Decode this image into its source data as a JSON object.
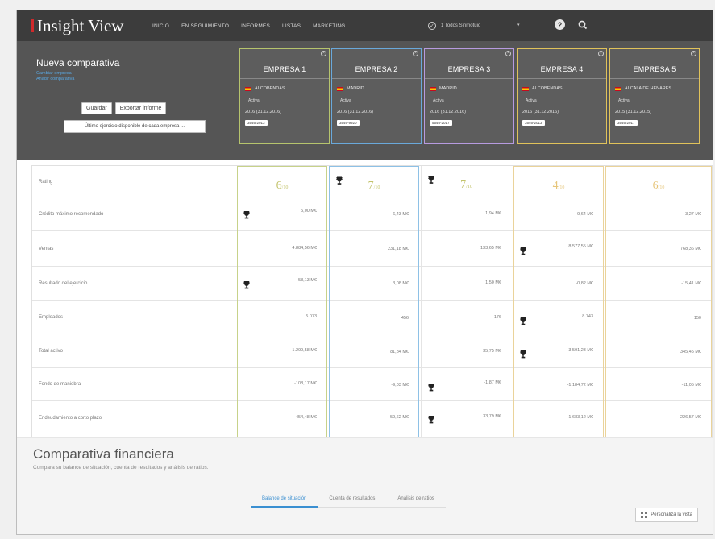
{
  "app": {
    "logo": "Insight View"
  },
  "nav": [
    "INICIO",
    "EN SEGUIMIENTO",
    "INFORMES",
    "LISTAS",
    "MARKETING"
  ],
  "user": {
    "label": "1 Todos Sinmotuio"
  },
  "header": {
    "title": "Nueva comparativa",
    "links": [
      "Cambiar empresa",
      "Añadir comparativa"
    ],
    "buttons": {
      "save": "Guardar",
      "export": "Exportar informe"
    },
    "period_select": "Último ejercicio disponible de cada empresa ..."
  },
  "companies": [
    {
      "name": "EMPRESA 1",
      "location": "ALCOBENDAS",
      "status": "Activa",
      "date": "2016 (31.12.2016)",
      "code": "3546-2013",
      "color": "#b6c46d"
    },
    {
      "name": "EMPRESA 2",
      "location": "MADRID",
      "status": "Activa",
      "date": "2016 (31.12.2016)",
      "code": "3546-9920",
      "color": "#6aa9db"
    },
    {
      "name": "EMPRESA 3",
      "location": "MADRID",
      "status": "Activa",
      "date": "2016 (31.12.2016)",
      "code": "5546-2017",
      "color": "#b79be0"
    },
    {
      "name": "EMPRESA 4",
      "location": "ALCOBENDAS",
      "status": "Activa",
      "date": "2016 (31.12.2016)",
      "code": "3546-2013",
      "color": "#e0c25a"
    },
    {
      "name": "EMPRESA 5",
      "location": "ALCALA DE HENARES",
      "status": "Activa",
      "date": "2015 (31.12.2015)",
      "code": "3546-2017",
      "color": "#e0c25a"
    }
  ],
  "table": {
    "rows": [
      "Rating",
      "Crédito máximo recomendado",
      "Ventas",
      "Resultado del ejercicio",
      "Empleados",
      "Total activo",
      "Fondo de maniobra",
      "Endeudamiento a corto plazo"
    ],
    "ratings": [
      {
        "value": "6",
        "suffix": "/10",
        "color": "#c3c36b"
      },
      {
        "value": "7",
        "suffix": "/10",
        "color": "#c3c36b"
      },
      {
        "value": "7",
        "suffix": "/10",
        "color": "#c3c36b"
      },
      {
        "value": "4",
        "suffix": "/10",
        "color": "#e6c57a"
      },
      {
        "value": "6",
        "suffix": "/10",
        "color": "#e6c57a"
      }
    ],
    "values": [
      [
        "5,00 M€",
        "6,43 M€",
        "1,94 M€",
        "9,64 M€",
        "3,27 M€"
      ],
      [
        "4.884,56 M€",
        "231,18 M€",
        "133,65 M€",
        "8.577,55 M€",
        "768,36 M€"
      ],
      [
        "58,13 M€",
        "3,08 M€",
        "1,50 M€",
        "-0,82 M€",
        "-15,41 M€"
      ],
      [
        "5.073",
        "456",
        "176",
        "8.743",
        "150"
      ],
      [
        "1.299,58 M€",
        "81,84 M€",
        "35,75 M€",
        "3.591,23 M€",
        "345,45 M€"
      ],
      [
        "-108,17 M€",
        "-9,03 M€",
        "-1,87 M€",
        "-1.184,72 M€",
        "-11,05 M€"
      ],
      [
        "454,48 M€",
        "59,62 M€",
        "33,79 M€",
        "1.683,12 M€",
        "226,57 M€"
      ]
    ]
  },
  "bottom": {
    "title": "Comparativa financiera",
    "subtitle": "Compara su balance de situación, cuenta de resultados y análisis de ratios.",
    "tabs": [
      "Balance de situación",
      "Cuenta de resultados",
      "Análisis de ratios"
    ],
    "personalize": "Personaliza la vista"
  }
}
